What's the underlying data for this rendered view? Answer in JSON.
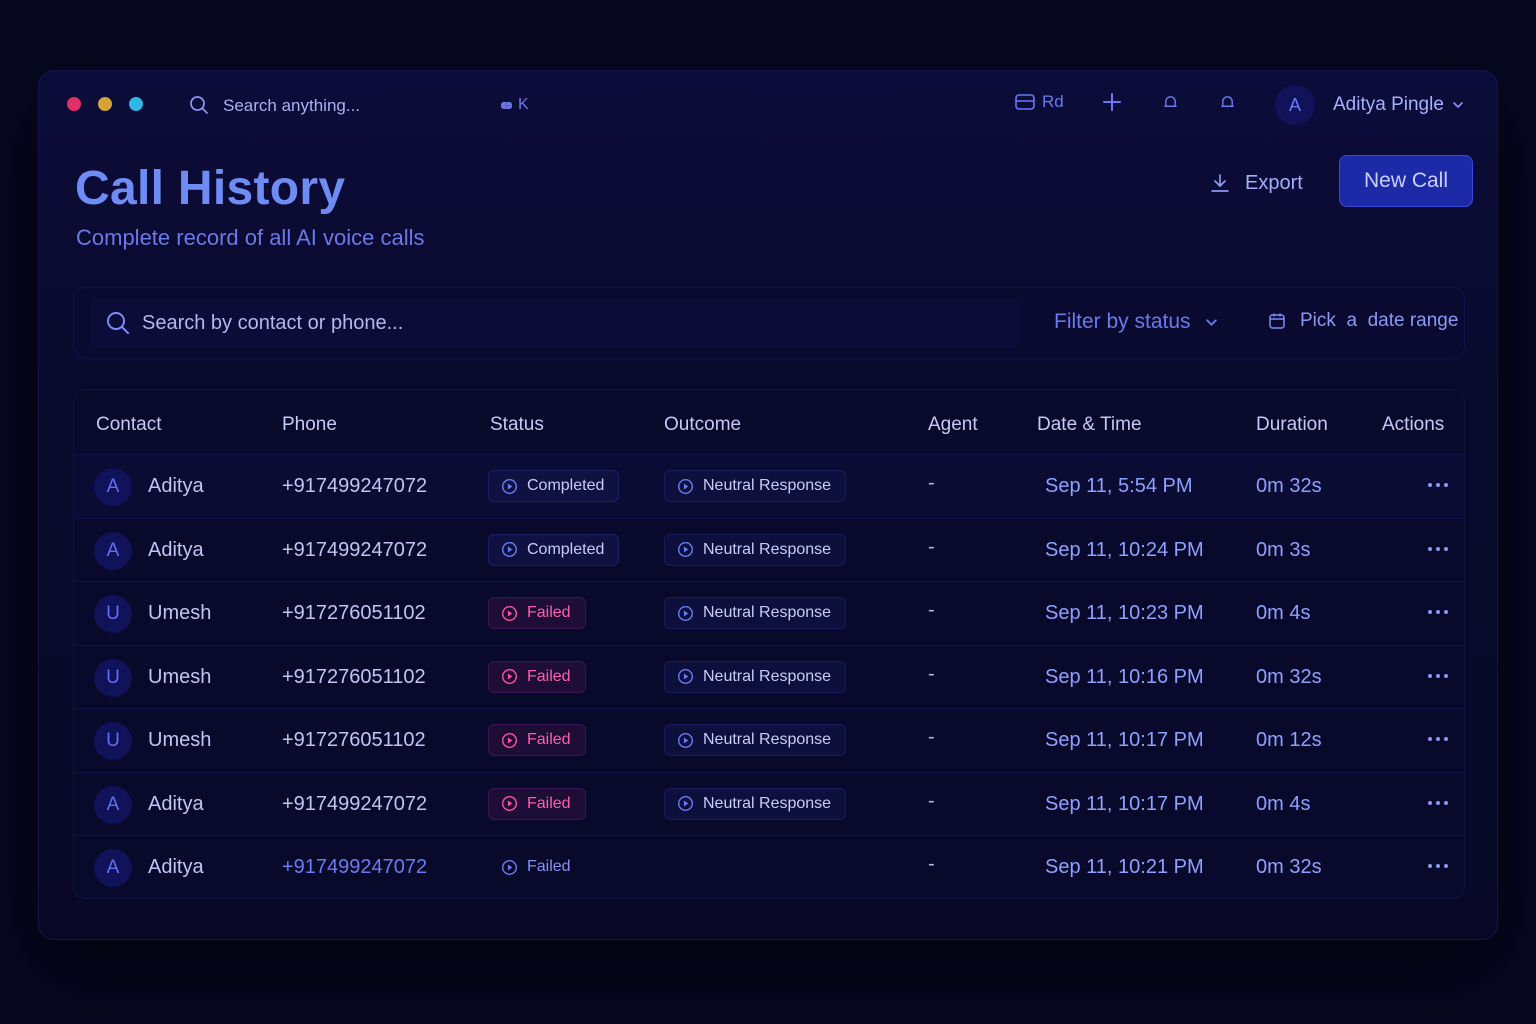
{
  "topbar": {
    "search_placeholder": "Search anything...",
    "shortcut_key": "K",
    "workspace_label": "Rd",
    "user_initial": "A",
    "user_name": "Aditya Pingle"
  },
  "header": {
    "title": "Call History",
    "subtitle": "Complete record of all AI voice calls",
    "export_label": "Export",
    "new_call_label": "New Call"
  },
  "filters": {
    "search_placeholder": "Search by contact or phone...",
    "status_label": "Filter by status",
    "date_label": "Pick  a  date range"
  },
  "table": {
    "columns": [
      "Contact",
      "Phone",
      "Status",
      "Outcome",
      "Agent",
      "Date & Time",
      "Duration",
      "Actions"
    ],
    "rows": [
      {
        "initial": "A",
        "name": "Aditya",
        "phone": "+917499247072",
        "status": "Completed",
        "outcome": "Neutral Response",
        "agent": "-",
        "datetime": "Sep 11, 5:54 PM",
        "duration": "0m 32s"
      },
      {
        "initial": "A",
        "name": "Aditya",
        "phone": "+917499247072",
        "status": "Completed",
        "outcome": "Neutral Response",
        "agent": "-",
        "datetime": "Sep 11, 10:24 PM",
        "duration": "0m 3s"
      },
      {
        "initial": "U",
        "name": "Umesh",
        "phone": "+917276051102",
        "status": "Failed",
        "outcome": "Neutral Response",
        "agent": "-",
        "datetime": "Sep 11, 10:23 PM",
        "duration": "0m 4s"
      },
      {
        "initial": "U",
        "name": "Umesh",
        "phone": "+917276051102",
        "status": "Failed",
        "outcome": "Neutral Response",
        "agent": "-",
        "datetime": "Sep 11, 10:16 PM",
        "duration": "0m 32s"
      },
      {
        "initial": "U",
        "name": "Umesh",
        "phone": "+917276051102",
        "status": "Failed",
        "outcome": "Neutral Response",
        "agent": "-",
        "datetime": "Sep 11, 10:17 PM",
        "duration": "0m 12s"
      },
      {
        "initial": "A",
        "name": "Aditya",
        "phone": "+917499247072",
        "status": "Failed",
        "outcome": "Neutral Response",
        "agent": "-",
        "datetime": "Sep 11, 10:17 PM",
        "duration": "0m 4s"
      },
      {
        "initial": "A",
        "name": "Aditya",
        "phone": "+917499247072",
        "status": "Failed",
        "outcome": "",
        "agent": "-",
        "datetime": "Sep 11, 10:21 PM",
        "duration": "0m 32s"
      }
    ]
  },
  "colors": {
    "background": "#070720",
    "accent": "#1c2aa8",
    "failed": "#ff5fae",
    "dot_red": "#e0306a",
    "dot_yellow": "#d8a23a",
    "dot_cyan": "#2fb6e6"
  },
  "icons": [
    "search-icon",
    "command-icon",
    "card-icon",
    "plus-icon",
    "bell-icon",
    "chevron-down-icon",
    "download-icon",
    "calendar-icon",
    "play-circle-icon",
    "more-horizontal-icon"
  ]
}
